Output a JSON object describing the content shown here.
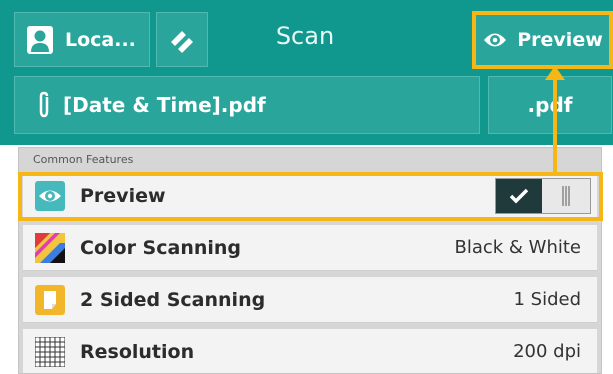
{
  "header": {
    "location_label": "Loca...",
    "title": "Scan",
    "preview_button_label": "Preview",
    "file_name": "[Date & Time].pdf",
    "file_format": ".pdf"
  },
  "section": {
    "title": "Common Features",
    "items": [
      {
        "label": "Preview",
        "value": ""
      },
      {
        "label": "Color Scanning",
        "value": "Black & White"
      },
      {
        "label": "2 Sided Scanning",
        "value": "1 Sided"
      },
      {
        "label": "Resolution",
        "value": "200 dpi"
      }
    ]
  },
  "toggle": {
    "state": "on"
  },
  "colors": {
    "header_teal": "#10988f",
    "highlight": "#f6b716",
    "toggle_on": "#1f3a3a"
  }
}
